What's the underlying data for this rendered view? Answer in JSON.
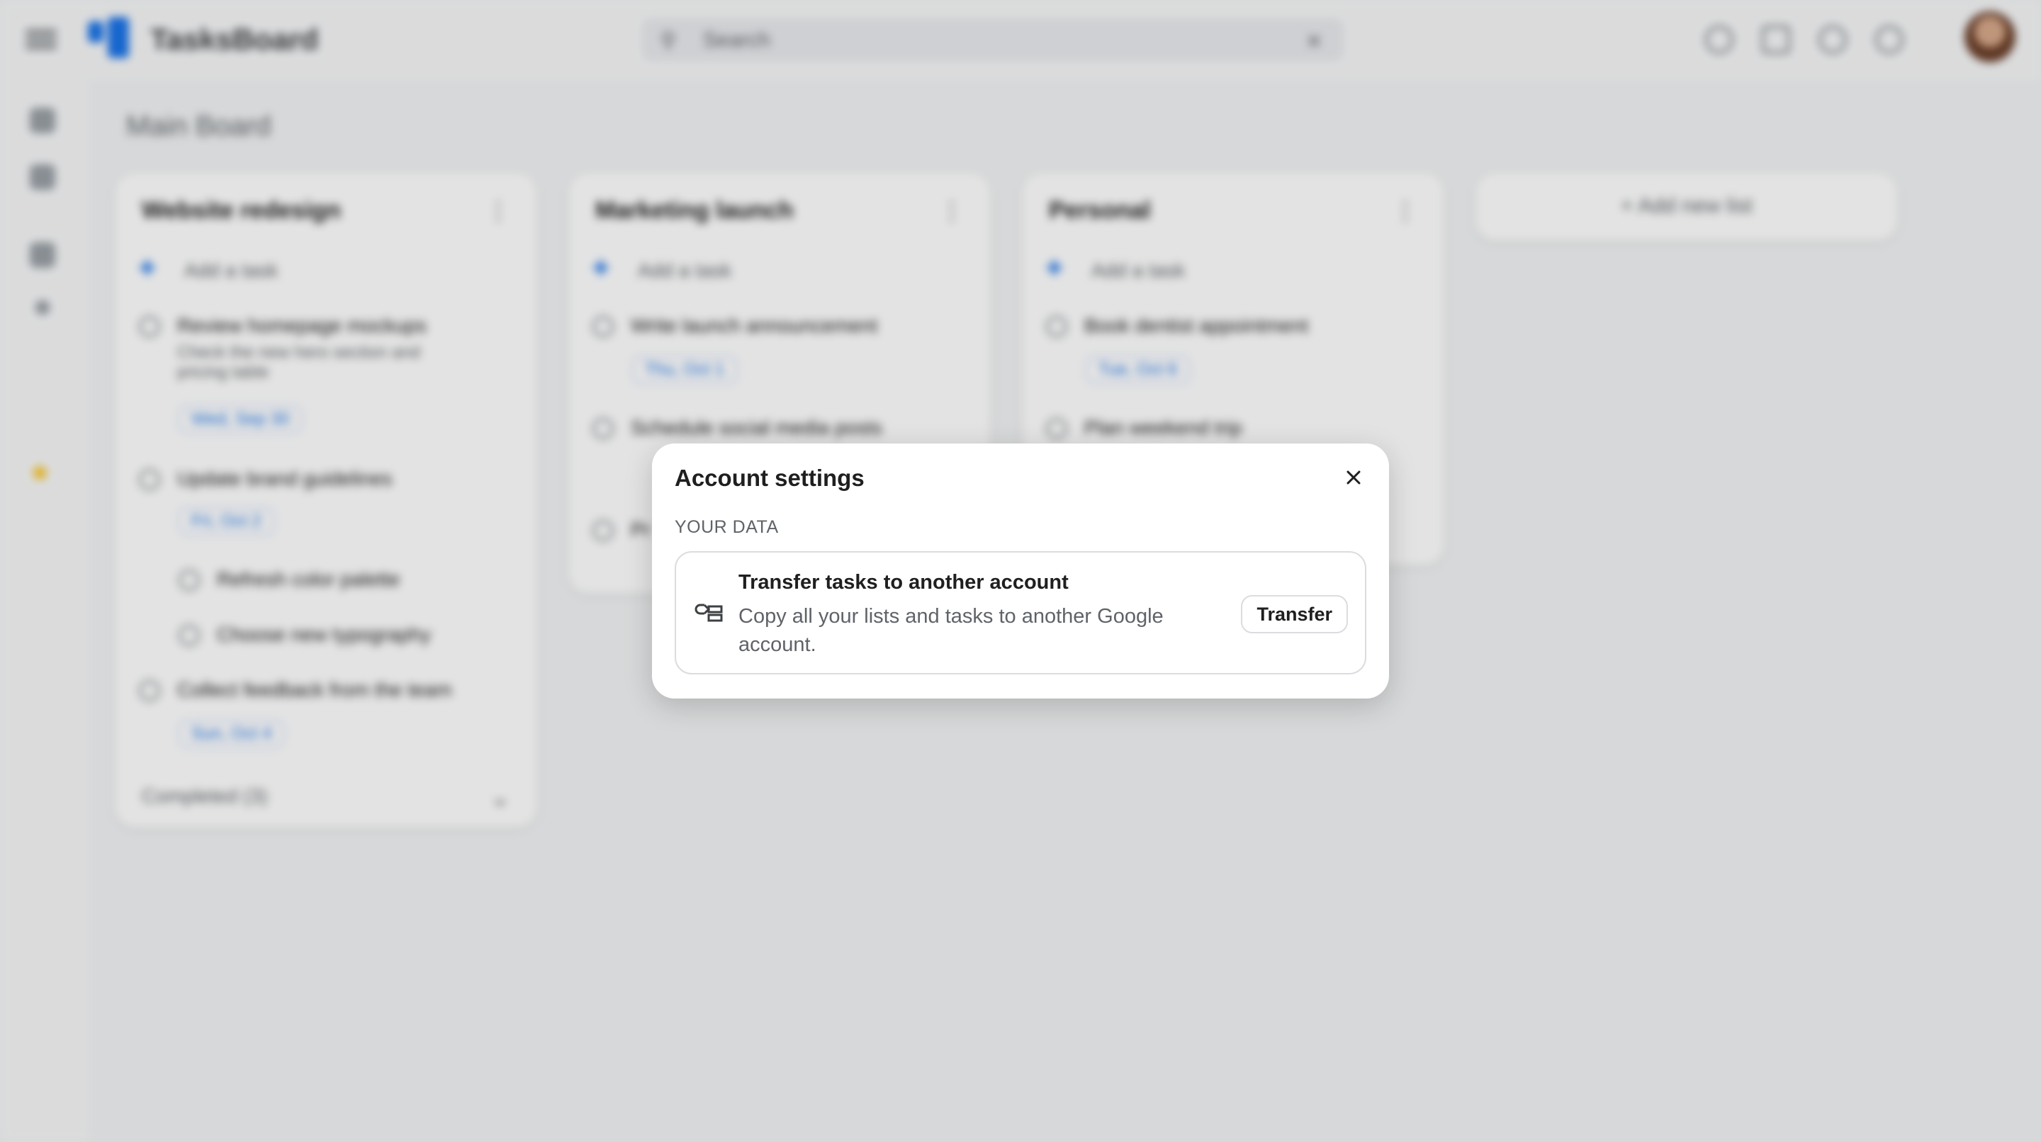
{
  "app": {
    "title": "TasksBoard",
    "search_placeholder": "Search",
    "board_title": "Main Board",
    "add_list_label": "+ Add new list"
  },
  "lists": [
    {
      "title": "Website redesign",
      "add_task": "Add a task",
      "tasks": [
        {
          "title": "Review homepage mockups",
          "note": "Check the new hero section and pricing table",
          "date": "Wed, Sep 30"
        },
        {
          "title": "Update brand guidelines",
          "date": "Fri, Oct 2"
        },
        {
          "title": "Refresh color palette"
        },
        {
          "title": "Choose new typography"
        },
        {
          "title": "Collect feedback from the team",
          "date": "Sun, Oct 4"
        }
      ],
      "completed": "Completed (3)"
    },
    {
      "title": "Marketing launch",
      "add_task": "Add a task",
      "tasks": [
        {
          "title": "Write launch announcement",
          "date": "Thu, Oct 1"
        },
        {
          "title": "Schedule social media posts"
        },
        {
          "title": "Pr"
        }
      ]
    },
    {
      "title": "Personal",
      "add_task": "Add a task",
      "tasks": [
        {
          "title": "Book dentist appointment",
          "date": "Tue, Oct 6"
        },
        {
          "title": "Plan weekend trip"
        }
      ]
    }
  ],
  "dialog": {
    "title": "Account settings",
    "section_label": "YOUR DATA",
    "card": {
      "title": "Transfer tasks to another account",
      "description": "Copy all your lists and tasks to another Google account.",
      "button_label": "Transfer",
      "icon": "transfer-icon"
    },
    "close_icon": "close-icon"
  },
  "colors": {
    "accent": "#1a73e8",
    "star": "#fbbc04",
    "text_primary": "#1f1f1f",
    "text_secondary": "#5f6368",
    "border": "#dadce0"
  }
}
